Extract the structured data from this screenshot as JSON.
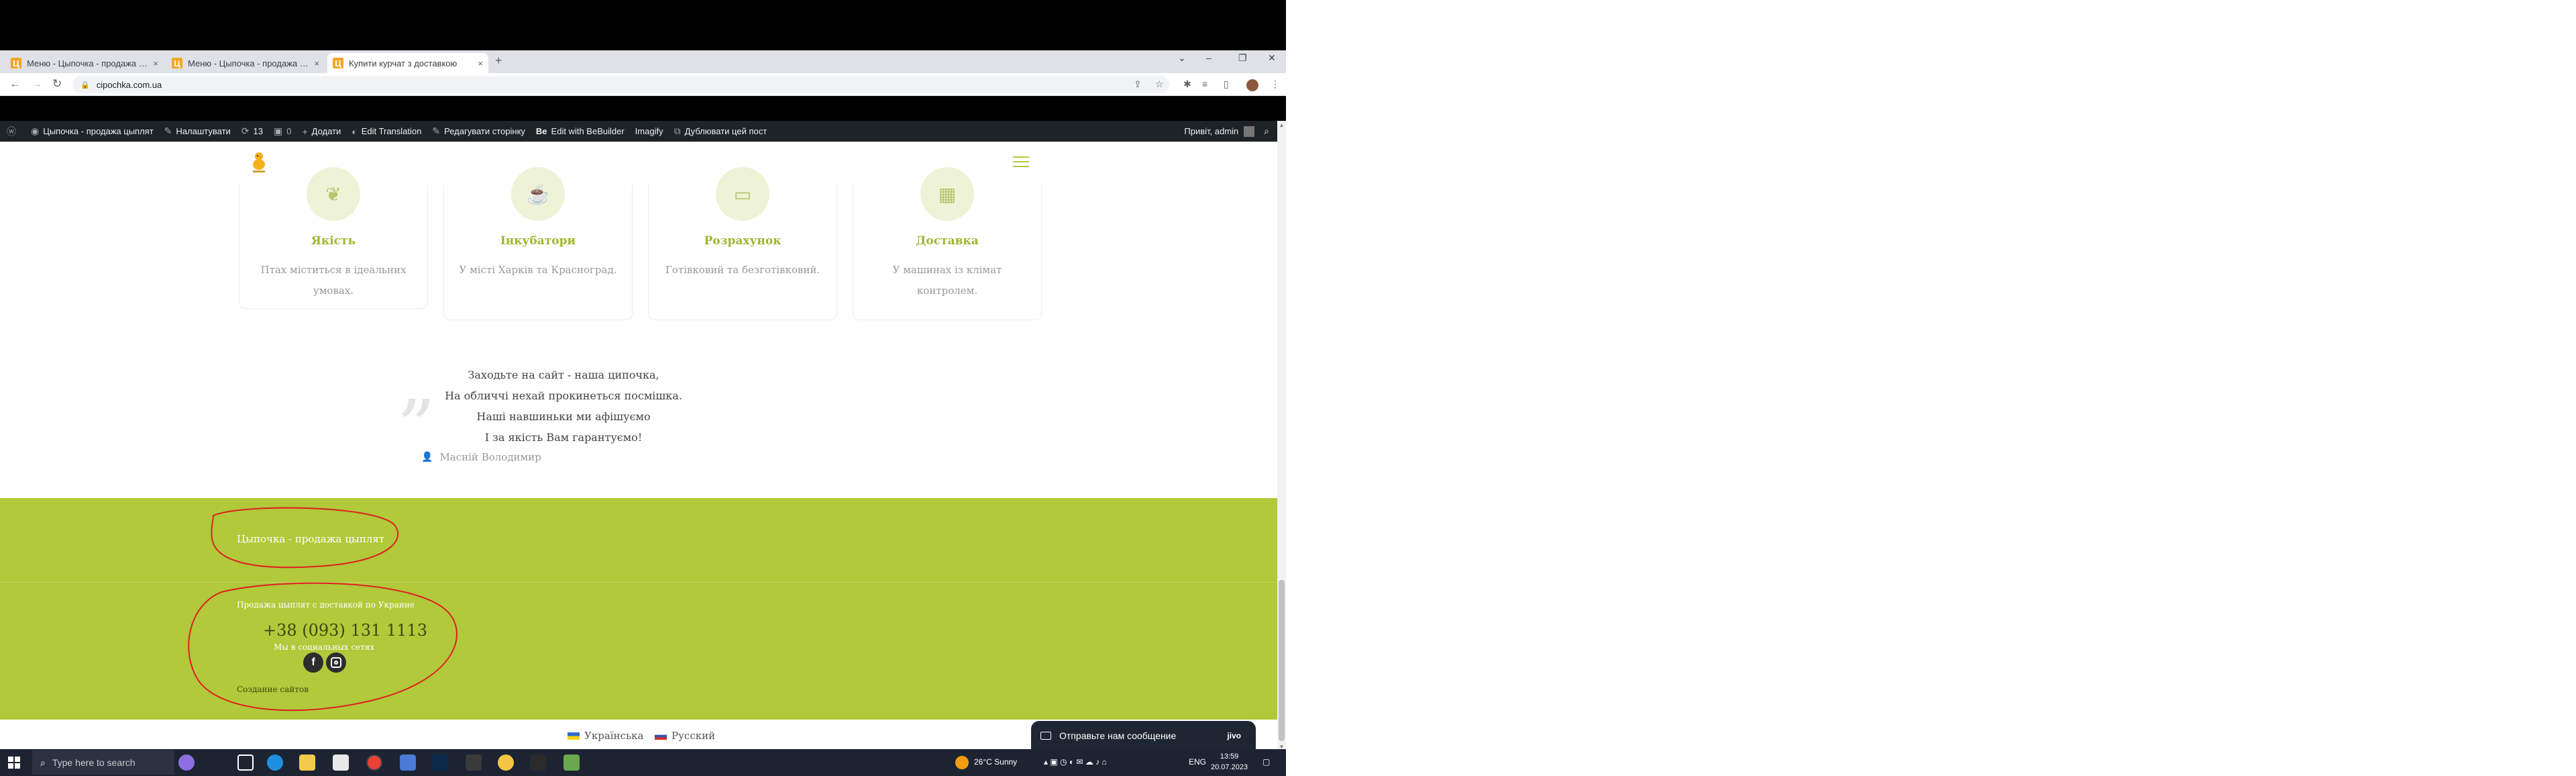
{
  "browser": {
    "tabs": [
      {
        "label": "Меню - Цыпочка - продажа цыпл",
        "active": false
      },
      {
        "label": "Меню - Цыпочка - продажа цыпл",
        "active": false
      },
      {
        "label": "Купити курчат з доставкою",
        "active": true
      }
    ],
    "favicon_letter": "Ц",
    "close_glyph": "×",
    "new_tab_glyph": "+",
    "url": "cipochka.com.ua"
  },
  "admin_bar": {
    "site_name": "Цыпочка - продажа цыплят",
    "customize": "Налаштувати",
    "updates_count": "13",
    "comments_count": "0",
    "add_new": "Додати",
    "edit_translation": "Edit Translation",
    "edit_page": "Редагувати сторінку",
    "bebuilder_icon": "Be",
    "bebuilder": "Edit with BeBuilder",
    "imagify": "Imagify",
    "duplicate": "Дублювати цей пост",
    "greeting": "Привіт, admin"
  },
  "features": [
    {
      "title": "Якість",
      "text": "Птах міститься в ідеальних умовах.",
      "icon": "leaf-icon"
    },
    {
      "title": "Інкубатори",
      "text": "У місті Харків та Красноград.",
      "icon": "cup-icon"
    },
    {
      "title": "Розрахунок",
      "text": "Готівковий та безготівковий.",
      "icon": "wallet-icon"
    },
    {
      "title": "Доставка",
      "text": "У машинах із клімат контролем.",
      "icon": "box-icon"
    }
  ],
  "quote": {
    "mark": "„",
    "lines": [
      "Заходьте на сайт - наша ципочка,",
      "На обличчі нехай прокинеться посмішка.",
      "Наші навшиньки ми афішуємо",
      "І за якість Вам гарантуємо!"
    ],
    "author": "Масній Володимир"
  },
  "footer": {
    "site_name": "Цыпочка - продажа цыплят",
    "description": "Продажа цыплят с доставкой по Украине",
    "phone": "+38 (093) 131 1113",
    "social_label": "Мы в социальных сетях",
    "facebook_glyph": "f",
    "created": "Создание сайтов"
  },
  "languages": [
    {
      "label": "Українська"
    },
    {
      "label": "Русский"
    }
  ],
  "chat": {
    "label": "Отправьте нам сообщение",
    "brand": "jivo"
  },
  "taskbar": {
    "search_placeholder": "Type here to search",
    "weather": "26°C  Sunny",
    "lang": "ENG",
    "time": "13:59",
    "date": "20.07.2023"
  },
  "colors": {
    "accent": "#b1c93a",
    "admin_bar": "#1d2327",
    "annotation": "#e02020"
  }
}
